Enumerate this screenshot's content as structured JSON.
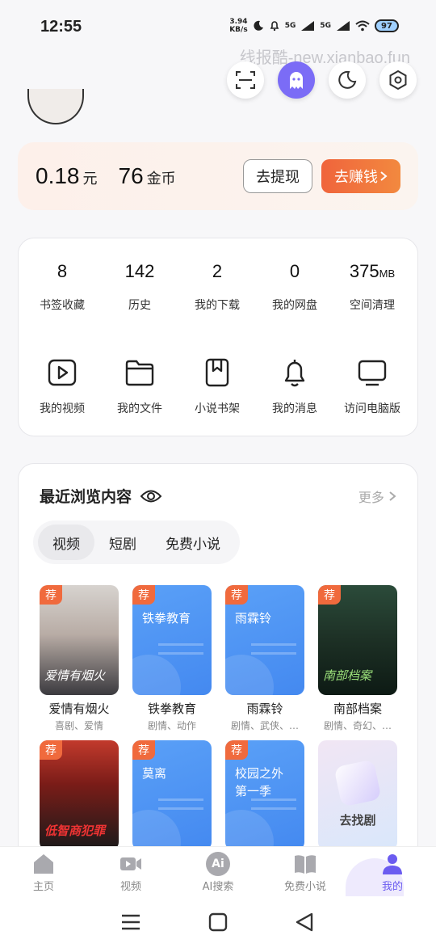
{
  "status": {
    "time": "12:55",
    "speed_value": "3.94",
    "speed_unit": "KB/s",
    "net1": "5G",
    "net2": "5G",
    "battery": "97"
  },
  "watermark": "线报酷-new.xianbao.fun",
  "top_actions": [
    "scan-icon",
    "ghost-icon",
    "moon-icon",
    "settings-icon"
  ],
  "wallet": {
    "yuan_value": "0.18",
    "yuan_unit": "元",
    "coin_value": "76",
    "coin_unit": "金币",
    "withdraw_label": "去提现",
    "earn_label": "去赚钱"
  },
  "stats": [
    {
      "value": "8",
      "unit": "",
      "label": "书签收藏"
    },
    {
      "value": "142",
      "unit": "",
      "label": "历史"
    },
    {
      "value": "2",
      "unit": "",
      "label": "我的下载"
    },
    {
      "value": "0",
      "unit": "",
      "label": "我的网盘"
    },
    {
      "value": "375",
      "unit": "MB",
      "label": "空间清理"
    }
  ],
  "tools": [
    {
      "icon": "video-play-icon",
      "label": "我的视频"
    },
    {
      "icon": "folder-icon",
      "label": "我的文件"
    },
    {
      "icon": "bookmark-book-icon",
      "label": "小说书架"
    },
    {
      "icon": "bell-icon",
      "label": "我的消息"
    },
    {
      "icon": "monitor-icon",
      "label": "访问电脑版"
    }
  ],
  "recent": {
    "title": "最近浏览内容",
    "more": "更多",
    "tabs": [
      "视频",
      "短剧",
      "免费小说"
    ],
    "badge": "荐",
    "row1": [
      {
        "title": "爱情有烟火",
        "sub": "喜剧、爱情",
        "poster_text": "爱情有烟火"
      },
      {
        "title": "铁拳教育",
        "sub": "剧情、动作",
        "poster_text": "铁拳教育"
      },
      {
        "title": "雨霖铃",
        "sub": "剧情、武侠、…",
        "poster_text": "雨霖铃"
      },
      {
        "title": "南部档案",
        "sub": "剧情、奇幻、…",
        "poster_text": "南部档案"
      }
    ],
    "row2": [
      {
        "poster_text": "低智商犯罪"
      },
      {
        "poster_text": "莫离"
      },
      {
        "poster_text": "校园之外第一季",
        "line1": "校园之外",
        "line2": "第一季"
      },
      {
        "find_label": "去找剧"
      }
    ]
  },
  "bottom_nav": [
    {
      "icon": "home-icon",
      "label": "主页"
    },
    {
      "icon": "video-camera-icon",
      "label": "视频"
    },
    {
      "icon": "ai-icon",
      "label": "AI搜索",
      "icon_text": "Ai"
    },
    {
      "icon": "open-book-icon",
      "label": "免费小说"
    },
    {
      "icon": "user-icon",
      "label": "我的",
      "active": true
    }
  ],
  "colors": {
    "accent": "#7b6cf6",
    "earn": "#f0643c",
    "badge": "#f06a3d",
    "poster_blue": "#4f94f4"
  }
}
